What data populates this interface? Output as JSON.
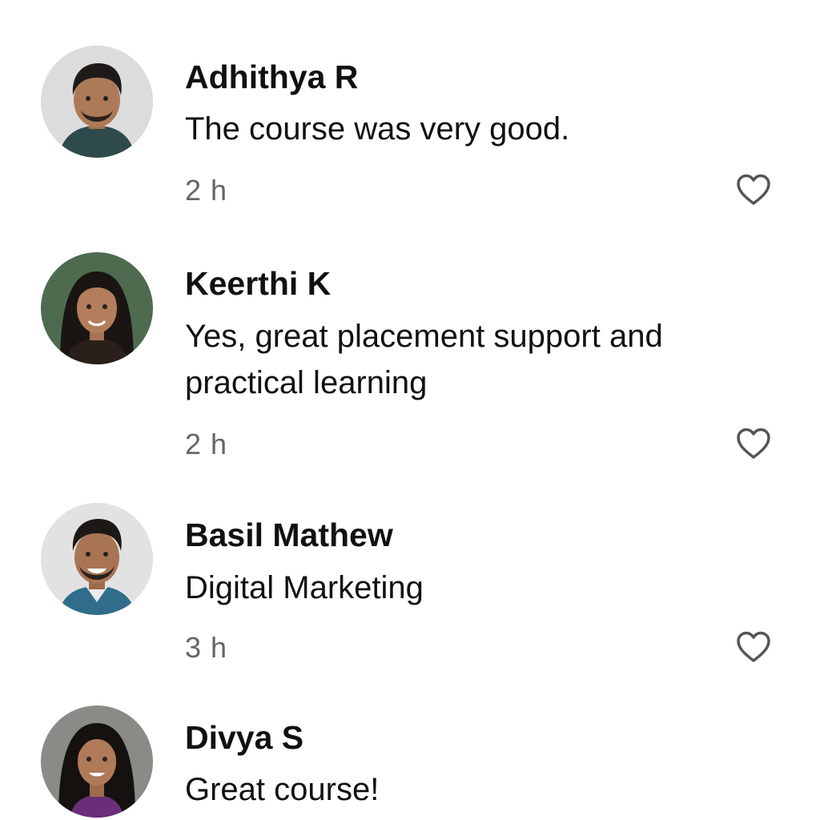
{
  "comments": [
    {
      "author": "Adhithya R",
      "text": "The course was very good.",
      "time": "2 h",
      "avatar": "male-avatar-1",
      "has_like": true
    },
    {
      "author": "Keerthi K",
      "text": "Yes, great placement support and practical learning",
      "time": "2 h",
      "avatar": "female-avatar-1",
      "has_like": true
    },
    {
      "author": "Basil Mathew",
      "text": "Digital Marketing",
      "time": "3 h",
      "avatar": "male-avatar-2",
      "has_like": true
    },
    {
      "author": "Divya S",
      "text": "Great course!",
      "avatar": "female-avatar-2",
      "has_like": false
    }
  ],
  "icons": {
    "like": "heart-outline-icon"
  },
  "colors": {
    "text": "#111111",
    "timestamp": "#666666",
    "icon": "#555555",
    "background": "#ffffff"
  }
}
